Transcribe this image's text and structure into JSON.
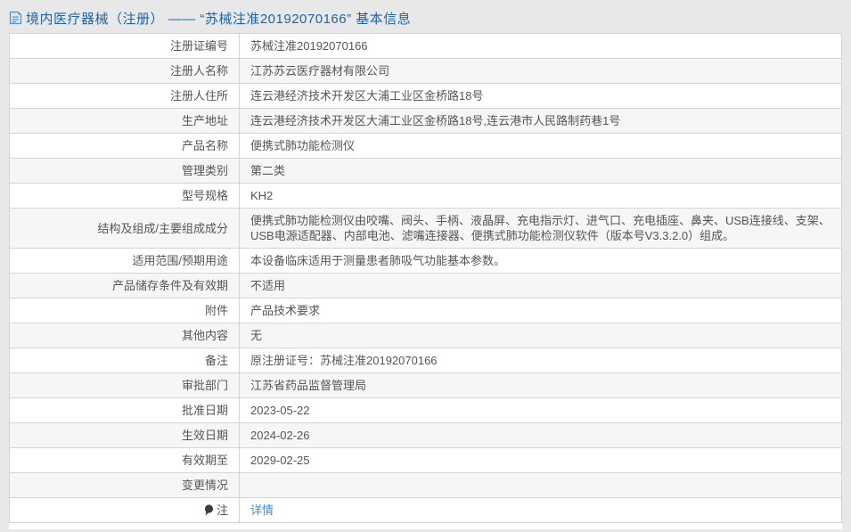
{
  "header": {
    "title": "境内医疗器械（注册） —— “苏械注准20192070166” 基本信息",
    "icon": "document-icon",
    "title_color": "#1a64ad"
  },
  "colors": {
    "page_background": "#e8e8e8",
    "table_stripe": "#f6f6f6",
    "border": "#d4d4d4",
    "link": "#428bca"
  },
  "table": {
    "rows": [
      {
        "label": "注册证编号",
        "value": "苏械注准20192070166"
      },
      {
        "label": "注册人名称",
        "value": "江苏苏云医疗器材有限公司"
      },
      {
        "label": "注册人住所",
        "value": "连云港经济技术开发区大浦工业区金桥路18号"
      },
      {
        "label": "生产地址",
        "value": "连云港经济技术开发区大浦工业区金桥路18号,连云港市人民路制药巷1号"
      },
      {
        "label": "产品名称",
        "value": "便携式肺功能检测仪"
      },
      {
        "label": "管理类别",
        "value": "第二类"
      },
      {
        "label": "型号规格",
        "value": "KH2"
      },
      {
        "label": "结构及组成/主要组成成分",
        "value": "便携式肺功能检测仪由咬嘴、阀头、手柄、液晶屏、充电指示灯、进气口、充电插座、鼻夹、USB连接线、支架、USB电源适配器、内部电池、滤嘴连接器、便携式肺功能检测仪软件（版本号V3.3.2.0）组成。"
      },
      {
        "label": "适用范围/预期用途",
        "value": "本设备临床适用于测量患者肺吸气功能基本参数。"
      },
      {
        "label": "产品储存条件及有效期",
        "value": "不适用"
      },
      {
        "label": "附件",
        "value": "产品技术要求"
      },
      {
        "label": "其他内容",
        "value": "无"
      },
      {
        "label": "备注",
        "value": "原注册证号：苏械注准20192070166"
      },
      {
        "label": "审批部门",
        "value": "江苏省药品监督管理局"
      },
      {
        "label": "批准日期",
        "value": "2023-05-22"
      },
      {
        "label": "生效日期",
        "value": "2024-02-26"
      },
      {
        "label": "有效期至",
        "value": "2029-02-25"
      },
      {
        "label": "变更情况",
        "value": ""
      },
      {
        "label": "注",
        "value": "详情",
        "label_icon": "note-balloon-icon",
        "value_is_link": true
      }
    ]
  }
}
